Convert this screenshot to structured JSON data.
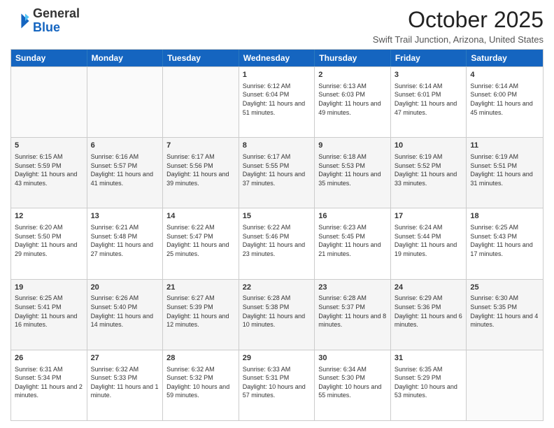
{
  "logo": {
    "general": "General",
    "blue": "Blue"
  },
  "title": "October 2025",
  "subtitle": "Swift Trail Junction, Arizona, United States",
  "headers": [
    "Sunday",
    "Monday",
    "Tuesday",
    "Wednesday",
    "Thursday",
    "Friday",
    "Saturday"
  ],
  "rows": [
    [
      {
        "day": "",
        "empty": true
      },
      {
        "day": "",
        "empty": true
      },
      {
        "day": "",
        "empty": true
      },
      {
        "day": "1",
        "sunrise": "6:12 AM",
        "sunset": "6:04 PM",
        "daylight": "11 hours and 51 minutes."
      },
      {
        "day": "2",
        "sunrise": "6:13 AM",
        "sunset": "6:03 PM",
        "daylight": "11 hours and 49 minutes."
      },
      {
        "day": "3",
        "sunrise": "6:14 AM",
        "sunset": "6:01 PM",
        "daylight": "11 hours and 47 minutes."
      },
      {
        "day": "4",
        "sunrise": "6:14 AM",
        "sunset": "6:00 PM",
        "daylight": "11 hours and 45 minutes."
      }
    ],
    [
      {
        "day": "5",
        "sunrise": "6:15 AM",
        "sunset": "5:59 PM",
        "daylight": "11 hours and 43 minutes."
      },
      {
        "day": "6",
        "sunrise": "6:16 AM",
        "sunset": "5:57 PM",
        "daylight": "11 hours and 41 minutes."
      },
      {
        "day": "7",
        "sunrise": "6:17 AM",
        "sunset": "5:56 PM",
        "daylight": "11 hours and 39 minutes."
      },
      {
        "day": "8",
        "sunrise": "6:17 AM",
        "sunset": "5:55 PM",
        "daylight": "11 hours and 37 minutes."
      },
      {
        "day": "9",
        "sunrise": "6:18 AM",
        "sunset": "5:53 PM",
        "daylight": "11 hours and 35 minutes."
      },
      {
        "day": "10",
        "sunrise": "6:19 AM",
        "sunset": "5:52 PM",
        "daylight": "11 hours and 33 minutes."
      },
      {
        "day": "11",
        "sunrise": "6:19 AM",
        "sunset": "5:51 PM",
        "daylight": "11 hours and 31 minutes."
      }
    ],
    [
      {
        "day": "12",
        "sunrise": "6:20 AM",
        "sunset": "5:50 PM",
        "daylight": "11 hours and 29 minutes."
      },
      {
        "day": "13",
        "sunrise": "6:21 AM",
        "sunset": "5:48 PM",
        "daylight": "11 hours and 27 minutes."
      },
      {
        "day": "14",
        "sunrise": "6:22 AM",
        "sunset": "5:47 PM",
        "daylight": "11 hours and 25 minutes."
      },
      {
        "day": "15",
        "sunrise": "6:22 AM",
        "sunset": "5:46 PM",
        "daylight": "11 hours and 23 minutes."
      },
      {
        "day": "16",
        "sunrise": "6:23 AM",
        "sunset": "5:45 PM",
        "daylight": "11 hours and 21 minutes."
      },
      {
        "day": "17",
        "sunrise": "6:24 AM",
        "sunset": "5:44 PM",
        "daylight": "11 hours and 19 minutes."
      },
      {
        "day": "18",
        "sunrise": "6:25 AM",
        "sunset": "5:43 PM",
        "daylight": "11 hours and 17 minutes."
      }
    ],
    [
      {
        "day": "19",
        "sunrise": "6:25 AM",
        "sunset": "5:41 PM",
        "daylight": "11 hours and 16 minutes."
      },
      {
        "day": "20",
        "sunrise": "6:26 AM",
        "sunset": "5:40 PM",
        "daylight": "11 hours and 14 minutes."
      },
      {
        "day": "21",
        "sunrise": "6:27 AM",
        "sunset": "5:39 PM",
        "daylight": "11 hours and 12 minutes."
      },
      {
        "day": "22",
        "sunrise": "6:28 AM",
        "sunset": "5:38 PM",
        "daylight": "11 hours and 10 minutes."
      },
      {
        "day": "23",
        "sunrise": "6:28 AM",
        "sunset": "5:37 PM",
        "daylight": "11 hours and 8 minutes."
      },
      {
        "day": "24",
        "sunrise": "6:29 AM",
        "sunset": "5:36 PM",
        "daylight": "11 hours and 6 minutes."
      },
      {
        "day": "25",
        "sunrise": "6:30 AM",
        "sunset": "5:35 PM",
        "daylight": "11 hours and 4 minutes."
      }
    ],
    [
      {
        "day": "26",
        "sunrise": "6:31 AM",
        "sunset": "5:34 PM",
        "daylight": "11 hours and 2 minutes."
      },
      {
        "day": "27",
        "sunrise": "6:32 AM",
        "sunset": "5:33 PM",
        "daylight": "11 hours and 1 minute."
      },
      {
        "day": "28",
        "sunrise": "6:32 AM",
        "sunset": "5:32 PM",
        "daylight": "10 hours and 59 minutes."
      },
      {
        "day": "29",
        "sunrise": "6:33 AM",
        "sunset": "5:31 PM",
        "daylight": "10 hours and 57 minutes."
      },
      {
        "day": "30",
        "sunrise": "6:34 AM",
        "sunset": "5:30 PM",
        "daylight": "10 hours and 55 minutes."
      },
      {
        "day": "31",
        "sunrise": "6:35 AM",
        "sunset": "5:29 PM",
        "daylight": "10 hours and 53 minutes."
      },
      {
        "day": "",
        "empty": true
      }
    ]
  ]
}
